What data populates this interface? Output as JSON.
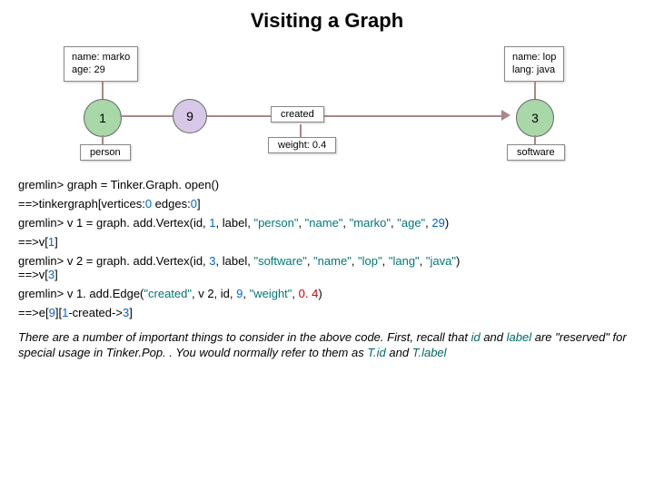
{
  "title": "Visiting  a  Graph",
  "diagram": {
    "node1_box_line1": "name: marko",
    "node1_box_line2": "age: 29",
    "node1_circle": "1",
    "node1_label": "person",
    "edge_id": "9",
    "edge_label": "created",
    "edge_weight": "weight: 0.4",
    "node3_box_line1": "name: lop",
    "node3_box_line2": "lang: java",
    "node3_circle": "3",
    "node3_label": "software"
  },
  "code": {
    "l1_a": "gremlin> graph = Tinker.Graph. open()",
    "l2_a": "==>tinkergraph[vertices:",
    "l2_b": "0",
    "l2_c": " edges:",
    "l2_d": "0",
    "l2_e": "]",
    "l3_a": "gremlin> v 1 = graph. add.Vertex(id, ",
    "l3_b": "1",
    "l3_c": ", label, ",
    "l3_d": "\"person\"",
    "l3_e": ", ",
    "l3_f": "\"name\"",
    "l3_g": ", ",
    "l3_h": "\"marko\"",
    "l3_i": ", ",
    "l3_j": "\"age\"",
    "l3_k": ", ",
    "l3_l": "29",
    "l3_m": ")",
    "l4_a": "==>v[",
    "l4_b": "1",
    "l4_c": "]",
    "l5_a": "gremlin> v 2 = graph. add.Vertex(id, ",
    "l5_b": "3",
    "l5_c": ", label, ",
    "l5_d": "\"software\"",
    "l5_e": ", ",
    "l5_f": "\"name\"",
    "l5_g": ", ",
    "l5_h": "\"lop\"",
    "l5_i": ", ",
    "l5_j": "\"lang\"",
    "l5_k": ", ",
    "l5_l": "\"java\"",
    "l5_m": ")",
    "l6_a": "==>v[",
    "l6_b": "3",
    "l6_c": "]",
    "l7_a": "gremlin> v 1. add.Edge(",
    "l7_b": "\"created\"",
    "l7_c": ", v 2, id, ",
    "l7_d": "9",
    "l7_e": ", ",
    "l7_f": "\"weight\"",
    "l7_g": ", ",
    "l7_h": "0. 4",
    "l7_i": ")",
    "l8_a": "==>e[",
    "l8_b": "9",
    "l8_c": "][",
    "l8_d": "1",
    "l8_e": "-created->",
    "l8_f": "3",
    "l8_g": "]"
  },
  "note": {
    "t1": "There are a number of important things to consider in the above code. First, recall that ",
    "id": "id",
    "t2": " and ",
    "label": "label",
    "t3": " are \"reserved\" for special usage in Tinker.Pop. . You would normally refer to them as ",
    "tid": "T.id",
    "t4": " and ",
    "tlabel": "T.label"
  }
}
